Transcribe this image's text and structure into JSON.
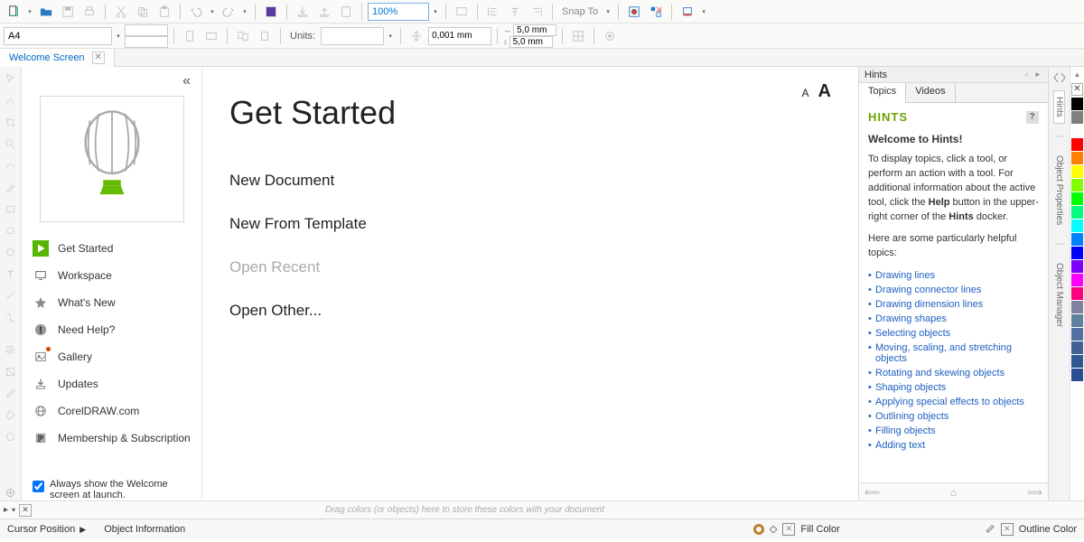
{
  "toolbar1": {
    "zoom_value": "100%",
    "snap_label": "Snap To"
  },
  "toolbar2": {
    "paper_size": "A4",
    "units_label": "Units:",
    "nudge_value": "0,001 mm",
    "dup_x": "5,0 mm",
    "dup_y": "5,0 mm"
  },
  "doc_tab": {
    "label": "Welcome Screen"
  },
  "welcome_nav": {
    "items": [
      {
        "label": "Get Started",
        "icon": "play",
        "active": true
      },
      {
        "label": "Workspace",
        "icon": "monitor"
      },
      {
        "label": "What's New",
        "icon": "star"
      },
      {
        "label": "Need Help?",
        "icon": "info"
      },
      {
        "label": "Gallery",
        "icon": "gallery",
        "dot": true
      },
      {
        "label": "Updates",
        "icon": "download"
      },
      {
        "label": "CorelDRAW.com",
        "icon": "globe"
      },
      {
        "label": "Membership & Subscription",
        "icon": "premium"
      }
    ],
    "always_show": "Always show the Welcome screen at launch."
  },
  "welcome_content": {
    "title": "Get Started",
    "items": [
      {
        "label": "New Document",
        "enabled": true
      },
      {
        "label": "New From Template",
        "enabled": true
      },
      {
        "label": "Open Recent",
        "enabled": false
      },
      {
        "label": "Open Other...",
        "enabled": true
      }
    ]
  },
  "hints": {
    "docker_title": "Hints",
    "tabs": {
      "topics": "Topics",
      "videos": "Videos"
    },
    "heading": "HINTS",
    "welcome": "Welcome to Hints!",
    "body1": "To display topics, click a tool, or perform an action with a tool. For additional information about the active tool, click the ",
    "body1b": "Help",
    "body1c": " button in the upper-right corner of the ",
    "body1d": "Hints",
    "body1e": " docker.",
    "body2": "Here are some particularly helpful topics:",
    "links": [
      "Drawing lines",
      "Drawing connector lines",
      "Drawing dimension lines",
      "Drawing shapes",
      "Selecting objects",
      "Moving, scaling, and stretching objects",
      "Rotating and skewing objects",
      "Shaping objects",
      "Applying special effects to objects",
      "Outlining objects",
      "Filling objects",
      "Adding text"
    ]
  },
  "right_strip": {
    "labels": [
      "Hints",
      "Object Properties",
      "Object Manager"
    ]
  },
  "color_tray": {
    "hint": "Drag colors (or objects) here to store these colors with your document"
  },
  "status": {
    "cursor": "Cursor Position",
    "object_info": "Object Information",
    "fill": "Fill Color",
    "outline": "Outline Color"
  },
  "palette": [
    "#000",
    "#7f7f7f",
    "#ffffff",
    "#ff0000",
    "#ff8000",
    "#ffff00",
    "#80ff00",
    "#00ff00",
    "#00ff80",
    "#00ffff",
    "#0080ff",
    "#0000ff",
    "#8000ff",
    "#ff00ff",
    "#ff0080",
    "#8080a0",
    "#6080a0",
    "#5070a0",
    "#406090",
    "#305890",
    "#285090"
  ]
}
